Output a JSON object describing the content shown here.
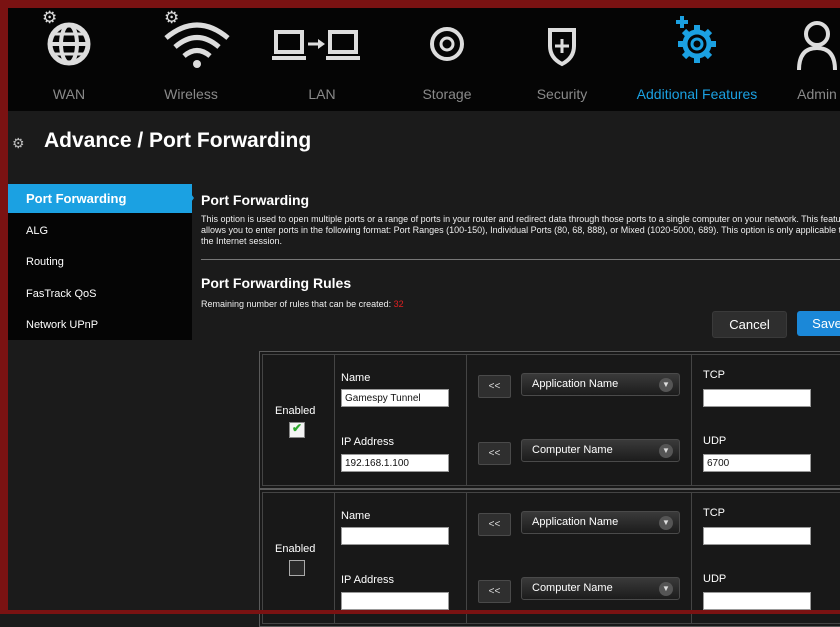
{
  "nav": {
    "items": [
      {
        "label": "WAN",
        "icon": "globe-icon"
      },
      {
        "label": "Wireless",
        "icon": "wifi-icon"
      },
      {
        "label": "LAN",
        "icon": "lan-icon"
      },
      {
        "label": "Storage",
        "icon": "storage-icon"
      },
      {
        "label": "Security",
        "icon": "shield-icon"
      },
      {
        "label": "Additional Features",
        "icon": "gear-icon"
      },
      {
        "label": "Admin",
        "icon": "person-icon"
      }
    ],
    "active_index": 5
  },
  "page": {
    "title": "Advance / Port Forwarding"
  },
  "sidebar": {
    "items": [
      {
        "label": "Port Forwarding"
      },
      {
        "label": "ALG"
      },
      {
        "label": "Routing"
      },
      {
        "label": "FasTrack QoS"
      },
      {
        "label": "Network UPnP"
      }
    ]
  },
  "main": {
    "heading": "Port Forwarding",
    "description": "This option is used to open multiple ports or a range of ports in your router and redirect data through those ports to a single computer on your network. This feature allows you to enter ports in the following format: Port Ranges (100-150), Individual Ports (80, 68, 888), or Mixed (1020-5000, 689). This option is only applicable to the Internet session.",
    "rules_heading": "Port Forwarding Rules",
    "remaining_label": "Remaining number of rules that can be created:",
    "remaining_count": "32"
  },
  "actions": {
    "cancel_label": "Cancel",
    "save_label": "Save"
  },
  "rules": [
    {
      "enabled_label": "Enabled",
      "enabled": true,
      "name_label": "Name",
      "name_value": "Gamespy Tunnel",
      "ip_label": "IP Address",
      "ip_value": "192.168.1.100",
      "arrow_label": "<<",
      "app_dropdown": "Application Name",
      "computer_dropdown": "Computer Name",
      "tcp_label": "TCP",
      "tcp_value": "",
      "udp_label": "UDP",
      "udp_value": "6700"
    },
    {
      "enabled_label": "Enabled",
      "enabled": false,
      "name_label": "Name",
      "name_value": "",
      "ip_label": "IP Address",
      "ip_value": "",
      "arrow_label": "<<",
      "app_dropdown": "Application Name",
      "computer_dropdown": "Computer Name",
      "tcp_label": "TCP",
      "tcp_value": "",
      "udp_label": "UDP",
      "udp_value": ""
    }
  ],
  "colors": {
    "accent": "#1ba1e2",
    "frame": "#7a1212",
    "remaining_count": "#e02020"
  }
}
